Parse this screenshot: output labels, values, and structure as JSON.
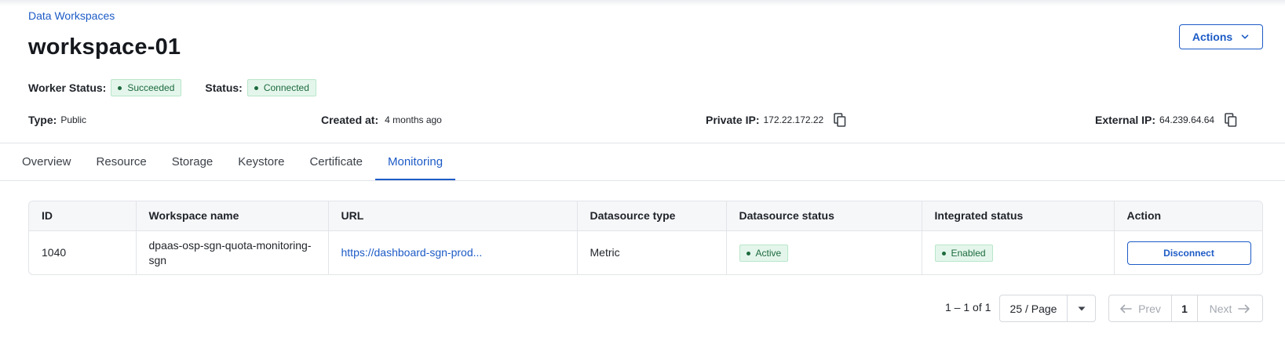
{
  "breadcrumb": {
    "label": "Data Workspaces"
  },
  "header": {
    "title": "workspace-01",
    "actions_label": "Actions",
    "actions_icon": "chevron-down-icon"
  },
  "status": {
    "worker_status_label": "Worker Status:",
    "worker_status_value": "Succeeded",
    "status_label": "Status:",
    "status_value": "Connected",
    "badge_color": "#e4f6ec"
  },
  "info": {
    "type_label": "Type:",
    "type_value": "Public",
    "created_label": "Created at:",
    "created_value": "4 months ago",
    "private_ip_label": "Private IP:",
    "private_ip_value": "172.22.172.22",
    "external_ip_label": "External IP:",
    "external_ip_value": "64.239.64.64",
    "copy_icon": "copy-icon"
  },
  "tabs": [
    {
      "label": "Overview",
      "active": false
    },
    {
      "label": "Resource",
      "active": false
    },
    {
      "label": "Storage",
      "active": false
    },
    {
      "label": "Keystore",
      "active": false
    },
    {
      "label": "Certificate",
      "active": false
    },
    {
      "label": "Monitoring",
      "active": true
    }
  ],
  "table": {
    "columns": [
      "ID",
      "Workspace name",
      "URL",
      "Datasource type",
      "Datasource status",
      "Integrated status",
      "Action"
    ],
    "rows": [
      {
        "id": "1040",
        "workspace_name": "dpaas-osp-sgn-quota-monitoring-sgn",
        "url": "https://dashboard-sgn-prod...",
        "datasource_type": "Metric",
        "datasource_status": "Active",
        "integrated_status": "Enabled",
        "action": "Disconnect"
      }
    ]
  },
  "pagination": {
    "range": "1 – 1 of 1",
    "page_size": "25 / Page",
    "prev": "Prev",
    "current_page": "1",
    "next": "Next"
  },
  "colors": {
    "accent": "#1d5bc6",
    "success_bg": "#e4f6ec",
    "success_text": "#1c6a3d"
  }
}
